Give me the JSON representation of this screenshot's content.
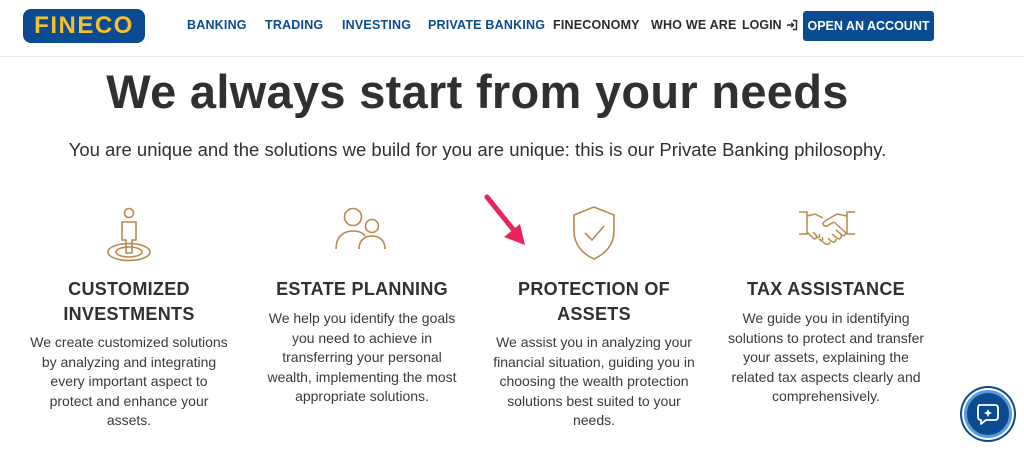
{
  "brand": {
    "logo_text": "FINECO",
    "primary_color": "#0a4b91",
    "logo_text_color": "#f5c02b"
  },
  "nav": {
    "items": [
      {
        "label": "BANKING"
      },
      {
        "label": "TRADING"
      },
      {
        "label": "INVESTING"
      },
      {
        "label": "PRIVATE BANKING"
      },
      {
        "label": "FINECONOMY"
      },
      {
        "label": "WHO WE ARE"
      }
    ],
    "login_label": "LOGIN",
    "login_icon": "login-icon",
    "cta_label": "OPEN AN ACCOUNT"
  },
  "hero": {
    "title": "We always start from your needs",
    "subtitle": "You are unique and the solutions we build for you are unique: this is our Private Banking philosophy."
  },
  "features": [
    {
      "icon": "person-target-icon",
      "title_lines": [
        "CUSTOMIZED",
        "INVESTMENTS"
      ],
      "desc_lines": [
        "We create customized solutions",
        "by analyzing and integrating",
        "every important aspect to",
        "protect and enhance your",
        "assets."
      ]
    },
    {
      "icon": "people-icon",
      "title_lines": [
        "ESTATE PLANNING"
      ],
      "desc_lines": [
        "We help you identify the goals",
        "you need to achieve in",
        "transferring your personal",
        "wealth, implementing the most",
        "appropriate solutions."
      ]
    },
    {
      "icon": "shield-check-icon",
      "title_lines": [
        "PROTECTION OF",
        "ASSETS"
      ],
      "desc_lines": [
        "We assist you in analyzing your",
        "financial situation, guiding you in",
        "choosing the wealth protection",
        "solutions best suited to your",
        "needs."
      ]
    },
    {
      "icon": "handshake-icon",
      "title_lines": [
        "TAX ASSISTANCE"
      ],
      "desc_lines": [
        "We guide you in identifying",
        "solutions to protect and transfer",
        "your assets, explaining the",
        "related tax aspects clearly and",
        "comprehensively."
      ]
    }
  ],
  "annotation": {
    "icon": "pointer-arrow-icon",
    "color": "#e8245b"
  },
  "chat": {
    "icon": "chat-assistant-icon"
  },
  "colors": {
    "icon_gold": "#b88a4e",
    "text_dark": "#303030"
  }
}
